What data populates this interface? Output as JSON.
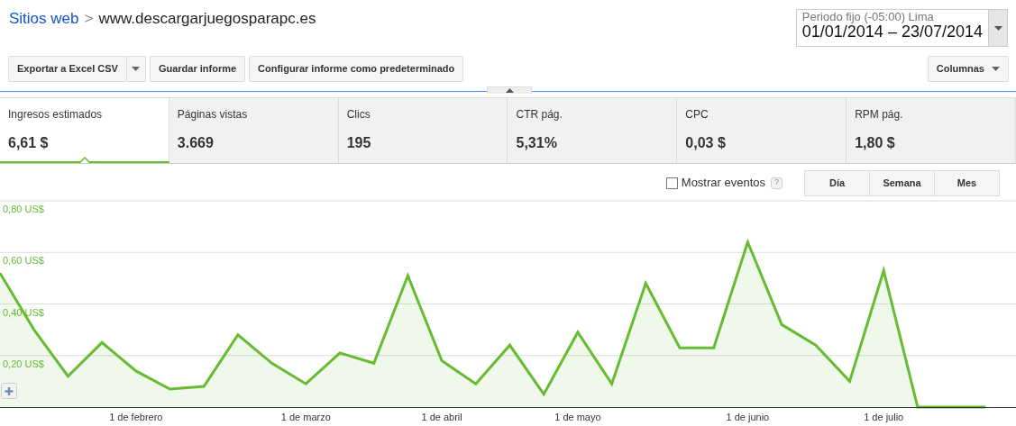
{
  "breadcrumb": {
    "link": "Sitios web",
    "separator": ">",
    "current": "www.descargarjuegosparapc.es"
  },
  "date_range": {
    "label": "Periodo fijo (-05:00) Lima",
    "value": "01/01/2014 – 23/07/2014"
  },
  "toolbar": [
    {
      "label": "Exportar a Excel CSV",
      "kind": "split"
    },
    {
      "label": "Guardar informe",
      "kind": "plain"
    },
    {
      "label": "Configurar informe como predeterminado",
      "kind": "plain"
    }
  ],
  "columns_button": {
    "label": "Columnas"
  },
  "metrics": [
    {
      "label": "Ingresos estimados",
      "value": "6,61 $",
      "selected": true
    },
    {
      "label": "Páginas vistas",
      "value": "3.669",
      "selected": false
    },
    {
      "label": "Clics",
      "value": "195",
      "selected": false
    },
    {
      "label": "CTR pág.",
      "value": "5,31%",
      "selected": false
    },
    {
      "label": "CPC",
      "value": "0,03 $",
      "selected": false
    },
    {
      "label": "RPM pág.",
      "value": "1,80 $",
      "selected": false
    }
  ],
  "show_events": {
    "label": "Mostrar eventos",
    "checked": false,
    "help": "?"
  },
  "granularity": [
    {
      "label": "Día",
      "selected": false
    },
    {
      "label": "Semana",
      "selected": false
    },
    {
      "label": "Mes",
      "selected": false
    }
  ],
  "chart": {
    "chart_data": {
      "type": "area",
      "categories": [
        null,
        null,
        null,
        null,
        "1 de febrero",
        null,
        null,
        null,
        null,
        "1 de marzo",
        null,
        null,
        null,
        "1 de abril",
        null,
        null,
        null,
        "1 de mayo",
        null,
        null,
        null,
        null,
        "1 de junio",
        null,
        null,
        null,
        "1 de julio",
        null,
        null,
        null
      ],
      "series": [
        {
          "color": "#66bb33",
          "values": [
            0.52,
            0.3,
            0.12,
            0.25,
            0.14,
            0.07,
            0.08,
            0.28,
            0.17,
            0.09,
            0.21,
            0.17,
            0.51,
            0.18,
            0.09,
            0.24,
            0.05,
            0.29,
            0.09,
            0.48,
            0.23,
            0.23,
            0.64,
            0.32,
            0.24,
            0.1,
            0.53,
            0,
            0,
            0
          ]
        }
      ],
      "ylim": [
        0,
        0.8
      ],
      "grid": true,
      "yticks": [
        {
          "value": 0.2,
          "label": "0,20 US$"
        },
        {
          "value": 0.4,
          "label": "0,40 US$"
        },
        {
          "value": 0.6,
          "label": "0,60 US$"
        },
        {
          "value": 0.8,
          "label": "0,80 US$"
        }
      ]
    }
  }
}
